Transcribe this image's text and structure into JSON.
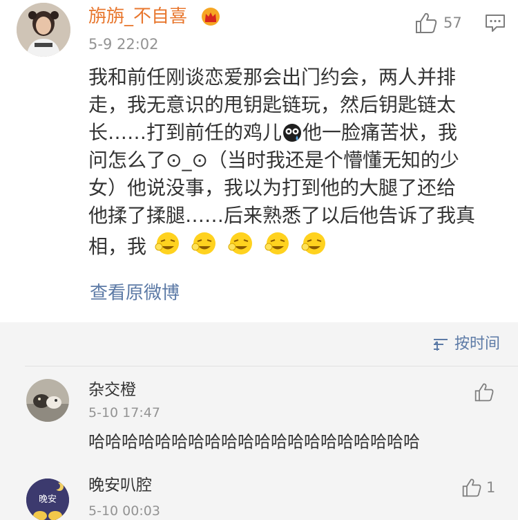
{
  "post": {
    "username": "旃旃_不自喜",
    "timestamp": "5-9 22:02",
    "like_count": "57",
    "content_lines": {
      "l1": "我和前任刚谈恋爱那会出门约会，两人并排",
      "l2": "走，我无意识的甩钥匙链玩，然后钥匙链太",
      "l3a": "长……打到前任的鸡儿",
      "l3b": "他一脸痛苦状，我",
      "l4": "问怎么了⊙_⊙（当时我还是个懵懂无知的少",
      "l5": "女）他说没事，我以为打到他的大腿了还给",
      "l6": "他揉了揉腿……后来熟悉了以后他告诉了我真",
      "l7": "相，我"
    },
    "view_original": "查看原微博"
  },
  "sort": {
    "label": "按时间"
  },
  "comments": [
    {
      "name": "杂交橙",
      "time": "5-10 17:47",
      "text": "哈哈哈哈哈哈哈哈哈哈哈哈哈哈哈哈哈哈哈哈"
    },
    {
      "name": "晚安叭腔",
      "time": "5-10 00:03",
      "like_count": "1",
      "avatar_text": "晚安"
    }
  ],
  "colors": {
    "username": "#e8772e",
    "link": "#5c7aa6",
    "time": "#939393",
    "section_bg": "#f4f4f4"
  },
  "icons": [
    "crown-icon",
    "like-icon",
    "comment-icon",
    "sort-icon",
    "crying-emoji",
    "laughing-emoji"
  ]
}
